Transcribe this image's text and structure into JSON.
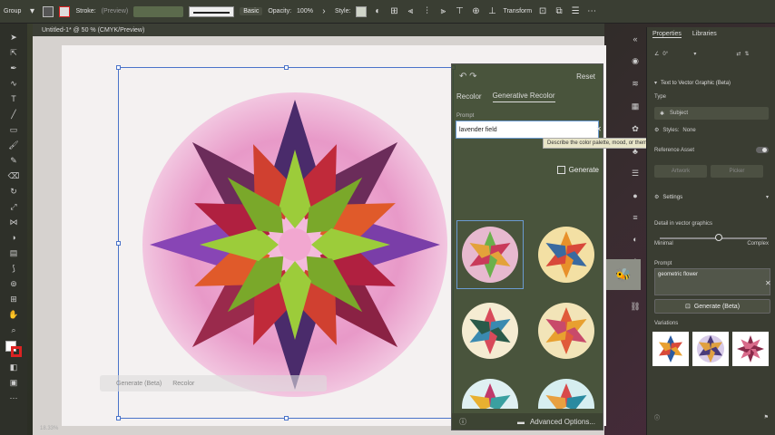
{
  "topbar": {
    "group_label": "Group",
    "stroke_label": "Stroke:",
    "stroke_preview": "(Preview)",
    "stroke_style": "Basic",
    "opacity_label": "Opacity:",
    "opacity_value": "100%",
    "style_label": "Style:",
    "transform_label": "Transform"
  },
  "document": {
    "tab_title": "Untitled-1* @ 50 % (CMYK/Preview)",
    "zoom": "18.33%"
  },
  "context_bar": {
    "item1": "Generate (Beta)",
    "item2": "Recolor"
  },
  "recolor_panel": {
    "reset": "Reset",
    "tab_recolor": "Recolor",
    "tab_generative": "Generative Recolor",
    "prompt_label": "Prompt",
    "prompt_value": "lavender field",
    "tooltip": "Describe the color palette, mood, or theme you want to generate",
    "generate": "Generate",
    "advanced": "Advanced Options..."
  },
  "properties": {
    "tab_properties": "Properties",
    "tab_libraries": "Libraries",
    "angle": "0°",
    "section_title": "Text to Vector Graphic (Beta)",
    "type_label": "Type",
    "type_value": "Subject",
    "styles_label": "Styles:",
    "styles_value": "None",
    "reference_asset": "Reference Asset",
    "artwork_btn": "Artwork",
    "picker_btn": "Picker",
    "settings": "Settings",
    "detail_label": "Detail in vector graphics",
    "detail_min": "Minimal",
    "detail_max": "Complex",
    "detail_value": 0.55,
    "prompt_label": "Prompt",
    "prompt_value": "geometric flower",
    "generate_beta": "Generate (Beta)",
    "variations": "Variations"
  }
}
